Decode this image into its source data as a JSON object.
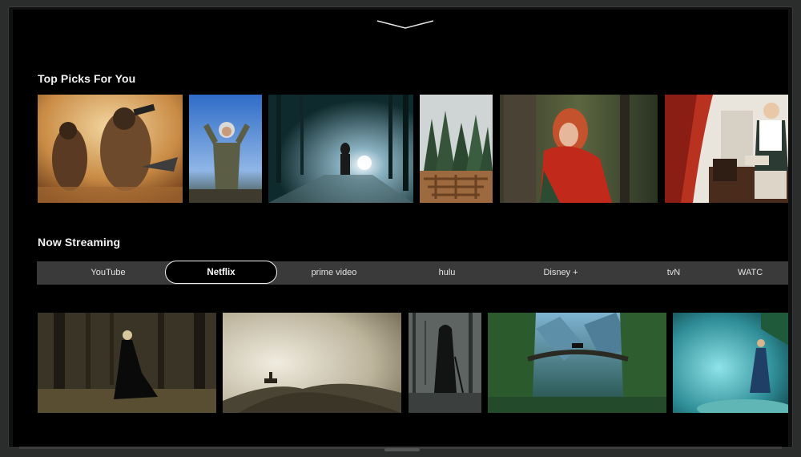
{
  "sections": {
    "top_picks": {
      "title": "Top Picks For You"
    },
    "now_streaming": {
      "title": "Now Streaming"
    }
  },
  "streaming_tabs": [
    {
      "label": "YouTube",
      "selected": false
    },
    {
      "label": "Netflix",
      "selected": true
    },
    {
      "label": "prime video",
      "selected": false
    },
    {
      "label": "hulu",
      "selected": false
    },
    {
      "label": "Disney +",
      "selected": false
    },
    {
      "label": "tvN",
      "selected": false
    },
    {
      "label": "WATC",
      "selected": false
    }
  ],
  "icons": {
    "collapse": "chevron-down-icon"
  },
  "colors": {
    "screen": "#000000",
    "tab_bar": "#3a3a3a",
    "text": "#f2f2f2"
  }
}
